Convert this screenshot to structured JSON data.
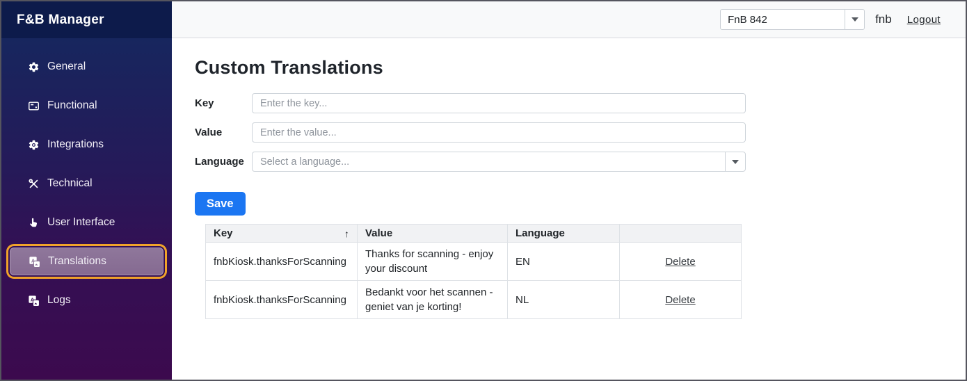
{
  "sidebar": {
    "title": "F&B Manager",
    "items": [
      {
        "label": "General",
        "icon": "gear"
      },
      {
        "label": "Functional",
        "icon": "card"
      },
      {
        "label": "Integrations",
        "icon": "gear-play"
      },
      {
        "label": "Technical",
        "icon": "tools"
      },
      {
        "label": "User Interface",
        "icon": "hand-pointer"
      },
      {
        "label": "Translations",
        "icon": "translate",
        "selected": true
      },
      {
        "label": "Logs",
        "icon": "translate"
      }
    ]
  },
  "header": {
    "location_select": {
      "value": "FnB 842"
    },
    "username": "fnb",
    "logout_label": "Logout"
  },
  "main": {
    "title": "Custom Translations",
    "form": {
      "key_label": "Key",
      "key_placeholder": "Enter the key...",
      "value_label": "Value",
      "value_placeholder": "Enter the value...",
      "language_label": "Language",
      "language_placeholder": "Select a language...",
      "save_label": "Save"
    },
    "table": {
      "columns": {
        "key": "Key",
        "value": "Value",
        "language": "Language",
        "action": ""
      },
      "sort": {
        "column": "Key",
        "direction": "asc",
        "indicator": "↑"
      },
      "rows": [
        {
          "key": "fnbKiosk.thanksForScanning",
          "value": "Thanks for scanning - enjoy your discount",
          "language": "EN",
          "action": "Delete"
        },
        {
          "key": "fnbKiosk.thanksForScanning",
          "value": "Bedankt voor het scannen - geniet van je korting!",
          "language": "NL",
          "action": "Delete"
        }
      ]
    }
  },
  "colors": {
    "sidebar_top": "#17265e",
    "sidebar_bottom": "#3c0a4e",
    "sidebar_header": "#0d1b4b",
    "selected_item_bg": "#8a7095",
    "selected_item_ring": "#f0a32a",
    "save_button": "#1b76f2",
    "topbar_bg": "#f8f9fa",
    "table_header_bg": "#f1f2f4",
    "table_border": "#dee2e6"
  }
}
